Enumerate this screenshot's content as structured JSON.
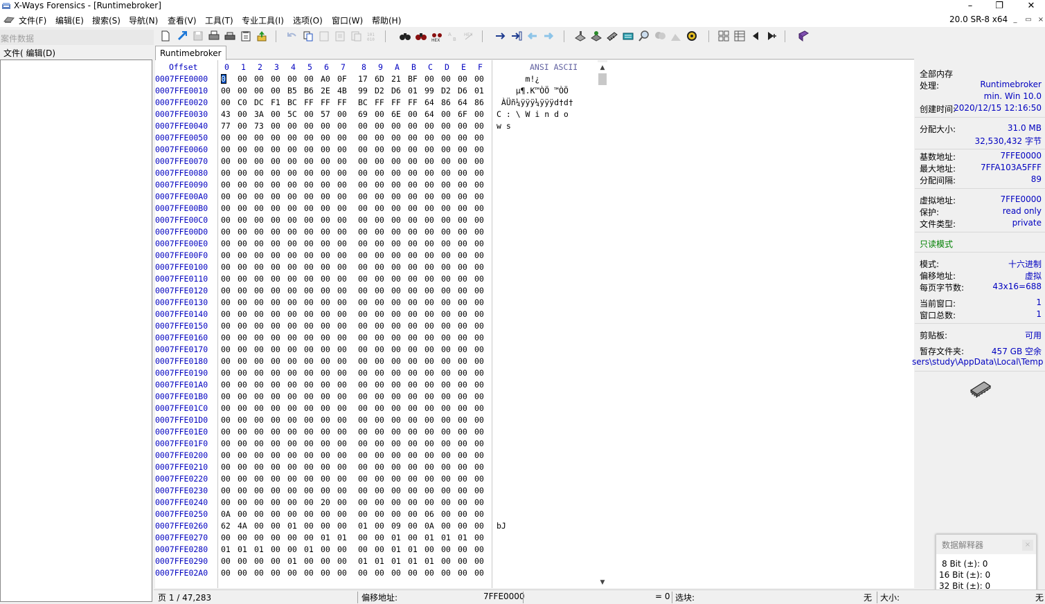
{
  "window": {
    "title": "X-Ways Forensics - [Runtimebroker]",
    "minimize": "–",
    "maximize": "❐",
    "close": "✕"
  },
  "menu": {
    "items": [
      "文件(F)",
      "编辑(E)",
      "搜索(S)",
      "导航(N)",
      "查看(V)",
      "工具(T)",
      "专业工具(I)",
      "选项(O)",
      "窗口(W)",
      "帮助(H)"
    ],
    "version": "20.0 SR-8 x64",
    "mdi_min": "_",
    "mdi_restore": "▭",
    "mdi_close": "×"
  },
  "left_panel": {
    "header": "案件数据",
    "menu_label": "文件(  编辑(D)"
  },
  "toolbar": {
    "icons": [
      "new-file-icon",
      "open-icon",
      "save-icon",
      "print-icon",
      "print-setup-icon",
      "properties-icon",
      "export-icon",
      "undo-icon",
      "copy-icon",
      "paste-icon",
      "paste-special-icon",
      "clipboard-icon",
      "convert-icon",
      "find-text-icon",
      "find-hex-icon",
      "find-hex-values-icon",
      "replace-text-icon",
      "replace-hex-icon",
      "goto-offset-icon",
      "goto-sector-icon",
      "back-icon",
      "forward-icon",
      "disk-icon",
      "disk-image-icon",
      "ram-icon",
      "calculator-icon",
      "search-icon",
      "fingerprint-icon",
      "chart-icon",
      "settings-gear-icon",
      "mode-icon",
      "layout-icon",
      "prev-icon",
      "next-icon",
      "case-icon"
    ]
  },
  "tab": {
    "label": "Runtimebroker"
  },
  "hex": {
    "offset_label": "Offset",
    "columns": [
      "0",
      "1",
      "2",
      "3",
      "4",
      "5",
      "6",
      "7",
      "8",
      "9",
      "A",
      "B",
      "C",
      "D",
      "E",
      "F"
    ],
    "ascii_label": "ANSI ASCII",
    "rows": [
      {
        "offset": "0007FFE0000",
        "bytes": [
          "00",
          "00",
          "00",
          "00",
          "00",
          "00",
          "A0",
          "0F",
          "17",
          "6D",
          "21",
          "BF",
          "00",
          "00",
          "00",
          "00"
        ],
        "ascii": "      m!¿"
      },
      {
        "offset": "0007FFE0010",
        "bytes": [
          "00",
          "00",
          "00",
          "00",
          "B5",
          "B6",
          "2E",
          "4B",
          "99",
          "D2",
          "D6",
          "01",
          "99",
          "D2",
          "D6",
          "01"
        ],
        "ascii": "    µ¶.K™ÒÖ ™ÒÖ"
      },
      {
        "offset": "0007FFE0020",
        "bytes": [
          "00",
          "C0",
          "DC",
          "F1",
          "BC",
          "FF",
          "FF",
          "FF",
          "BC",
          "FF",
          "FF",
          "FF",
          "64",
          "86",
          "64",
          "86"
        ],
        "ascii": " ÀÜñ¼ÿÿÿ¼ÿÿÿd†d†"
      },
      {
        "offset": "0007FFE0030",
        "bytes": [
          "43",
          "00",
          "3A",
          "00",
          "5C",
          "00",
          "57",
          "00",
          "69",
          "00",
          "6E",
          "00",
          "64",
          "00",
          "6F",
          "00"
        ],
        "ascii": "C : \\ W i n d o"
      },
      {
        "offset": "0007FFE0040",
        "bytes": [
          "77",
          "00",
          "73",
          "00",
          "00",
          "00",
          "00",
          "00",
          "00",
          "00",
          "00",
          "00",
          "00",
          "00",
          "00",
          "00"
        ],
        "ascii": "w s"
      },
      {
        "offset": "0007FFE0050",
        "bytes": [
          "00",
          "00",
          "00",
          "00",
          "00",
          "00",
          "00",
          "00",
          "00",
          "00",
          "00",
          "00",
          "00",
          "00",
          "00",
          "00"
        ],
        "ascii": ""
      },
      {
        "offset": "0007FFE0060",
        "bytes": [
          "00",
          "00",
          "00",
          "00",
          "00",
          "00",
          "00",
          "00",
          "00",
          "00",
          "00",
          "00",
          "00",
          "00",
          "00",
          "00"
        ],
        "ascii": ""
      },
      {
        "offset": "0007FFE0070",
        "bytes": [
          "00",
          "00",
          "00",
          "00",
          "00",
          "00",
          "00",
          "00",
          "00",
          "00",
          "00",
          "00",
          "00",
          "00",
          "00",
          "00"
        ],
        "ascii": ""
      },
      {
        "offset": "0007FFE0080",
        "bytes": [
          "00",
          "00",
          "00",
          "00",
          "00",
          "00",
          "00",
          "00",
          "00",
          "00",
          "00",
          "00",
          "00",
          "00",
          "00",
          "00"
        ],
        "ascii": ""
      },
      {
        "offset": "0007FFE0090",
        "bytes": [
          "00",
          "00",
          "00",
          "00",
          "00",
          "00",
          "00",
          "00",
          "00",
          "00",
          "00",
          "00",
          "00",
          "00",
          "00",
          "00"
        ],
        "ascii": ""
      },
      {
        "offset": "0007FFE00A0",
        "bytes": [
          "00",
          "00",
          "00",
          "00",
          "00",
          "00",
          "00",
          "00",
          "00",
          "00",
          "00",
          "00",
          "00",
          "00",
          "00",
          "00"
        ],
        "ascii": ""
      },
      {
        "offset": "0007FFE00B0",
        "bytes": [
          "00",
          "00",
          "00",
          "00",
          "00",
          "00",
          "00",
          "00",
          "00",
          "00",
          "00",
          "00",
          "00",
          "00",
          "00",
          "00"
        ],
        "ascii": ""
      },
      {
        "offset": "0007FFE00C0",
        "bytes": [
          "00",
          "00",
          "00",
          "00",
          "00",
          "00",
          "00",
          "00",
          "00",
          "00",
          "00",
          "00",
          "00",
          "00",
          "00",
          "00"
        ],
        "ascii": ""
      },
      {
        "offset": "0007FFE00D0",
        "bytes": [
          "00",
          "00",
          "00",
          "00",
          "00",
          "00",
          "00",
          "00",
          "00",
          "00",
          "00",
          "00",
          "00",
          "00",
          "00",
          "00"
        ],
        "ascii": ""
      },
      {
        "offset": "0007FFE00E0",
        "bytes": [
          "00",
          "00",
          "00",
          "00",
          "00",
          "00",
          "00",
          "00",
          "00",
          "00",
          "00",
          "00",
          "00",
          "00",
          "00",
          "00"
        ],
        "ascii": ""
      },
      {
        "offset": "0007FFE00F0",
        "bytes": [
          "00",
          "00",
          "00",
          "00",
          "00",
          "00",
          "00",
          "00",
          "00",
          "00",
          "00",
          "00",
          "00",
          "00",
          "00",
          "00"
        ],
        "ascii": ""
      },
      {
        "offset": "0007FFE0100",
        "bytes": [
          "00",
          "00",
          "00",
          "00",
          "00",
          "00",
          "00",
          "00",
          "00",
          "00",
          "00",
          "00",
          "00",
          "00",
          "00",
          "00"
        ],
        "ascii": ""
      },
      {
        "offset": "0007FFE0110",
        "bytes": [
          "00",
          "00",
          "00",
          "00",
          "00",
          "00",
          "00",
          "00",
          "00",
          "00",
          "00",
          "00",
          "00",
          "00",
          "00",
          "00"
        ],
        "ascii": ""
      },
      {
        "offset": "0007FFE0120",
        "bytes": [
          "00",
          "00",
          "00",
          "00",
          "00",
          "00",
          "00",
          "00",
          "00",
          "00",
          "00",
          "00",
          "00",
          "00",
          "00",
          "00"
        ],
        "ascii": ""
      },
      {
        "offset": "0007FFE0130",
        "bytes": [
          "00",
          "00",
          "00",
          "00",
          "00",
          "00",
          "00",
          "00",
          "00",
          "00",
          "00",
          "00",
          "00",
          "00",
          "00",
          "00"
        ],
        "ascii": ""
      },
      {
        "offset": "0007FFE0140",
        "bytes": [
          "00",
          "00",
          "00",
          "00",
          "00",
          "00",
          "00",
          "00",
          "00",
          "00",
          "00",
          "00",
          "00",
          "00",
          "00",
          "00"
        ],
        "ascii": ""
      },
      {
        "offset": "0007FFE0150",
        "bytes": [
          "00",
          "00",
          "00",
          "00",
          "00",
          "00",
          "00",
          "00",
          "00",
          "00",
          "00",
          "00",
          "00",
          "00",
          "00",
          "00"
        ],
        "ascii": ""
      },
      {
        "offset": "0007FFE0160",
        "bytes": [
          "00",
          "00",
          "00",
          "00",
          "00",
          "00",
          "00",
          "00",
          "00",
          "00",
          "00",
          "00",
          "00",
          "00",
          "00",
          "00"
        ],
        "ascii": ""
      },
      {
        "offset": "0007FFE0170",
        "bytes": [
          "00",
          "00",
          "00",
          "00",
          "00",
          "00",
          "00",
          "00",
          "00",
          "00",
          "00",
          "00",
          "00",
          "00",
          "00",
          "00"
        ],
        "ascii": ""
      },
      {
        "offset": "0007FFE0180",
        "bytes": [
          "00",
          "00",
          "00",
          "00",
          "00",
          "00",
          "00",
          "00",
          "00",
          "00",
          "00",
          "00",
          "00",
          "00",
          "00",
          "00"
        ],
        "ascii": ""
      },
      {
        "offset": "0007FFE0190",
        "bytes": [
          "00",
          "00",
          "00",
          "00",
          "00",
          "00",
          "00",
          "00",
          "00",
          "00",
          "00",
          "00",
          "00",
          "00",
          "00",
          "00"
        ],
        "ascii": ""
      },
      {
        "offset": "0007FFE01A0",
        "bytes": [
          "00",
          "00",
          "00",
          "00",
          "00",
          "00",
          "00",
          "00",
          "00",
          "00",
          "00",
          "00",
          "00",
          "00",
          "00",
          "00"
        ],
        "ascii": ""
      },
      {
        "offset": "0007FFE01B0",
        "bytes": [
          "00",
          "00",
          "00",
          "00",
          "00",
          "00",
          "00",
          "00",
          "00",
          "00",
          "00",
          "00",
          "00",
          "00",
          "00",
          "00"
        ],
        "ascii": ""
      },
      {
        "offset": "0007FFE01C0",
        "bytes": [
          "00",
          "00",
          "00",
          "00",
          "00",
          "00",
          "00",
          "00",
          "00",
          "00",
          "00",
          "00",
          "00",
          "00",
          "00",
          "00"
        ],
        "ascii": ""
      },
      {
        "offset": "0007FFE01D0",
        "bytes": [
          "00",
          "00",
          "00",
          "00",
          "00",
          "00",
          "00",
          "00",
          "00",
          "00",
          "00",
          "00",
          "00",
          "00",
          "00",
          "00"
        ],
        "ascii": ""
      },
      {
        "offset": "0007FFE01E0",
        "bytes": [
          "00",
          "00",
          "00",
          "00",
          "00",
          "00",
          "00",
          "00",
          "00",
          "00",
          "00",
          "00",
          "00",
          "00",
          "00",
          "00"
        ],
        "ascii": ""
      },
      {
        "offset": "0007FFE01F0",
        "bytes": [
          "00",
          "00",
          "00",
          "00",
          "00",
          "00",
          "00",
          "00",
          "00",
          "00",
          "00",
          "00",
          "00",
          "00",
          "00",
          "00"
        ],
        "ascii": ""
      },
      {
        "offset": "0007FFE0200",
        "bytes": [
          "00",
          "00",
          "00",
          "00",
          "00",
          "00",
          "00",
          "00",
          "00",
          "00",
          "00",
          "00",
          "00",
          "00",
          "00",
          "00"
        ],
        "ascii": ""
      },
      {
        "offset": "0007FFE0210",
        "bytes": [
          "00",
          "00",
          "00",
          "00",
          "00",
          "00",
          "00",
          "00",
          "00",
          "00",
          "00",
          "00",
          "00",
          "00",
          "00",
          "00"
        ],
        "ascii": ""
      },
      {
        "offset": "0007FFE0220",
        "bytes": [
          "00",
          "00",
          "00",
          "00",
          "00",
          "00",
          "00",
          "00",
          "00",
          "00",
          "00",
          "00",
          "00",
          "00",
          "00",
          "00"
        ],
        "ascii": ""
      },
      {
        "offset": "0007FFE0230",
        "bytes": [
          "00",
          "00",
          "00",
          "00",
          "00",
          "00",
          "00",
          "00",
          "00",
          "00",
          "00",
          "00",
          "00",
          "00",
          "00",
          "00"
        ],
        "ascii": ""
      },
      {
        "offset": "0007FFE0240",
        "bytes": [
          "00",
          "00",
          "00",
          "00",
          "00",
          "00",
          "20",
          "00",
          "00",
          "00",
          "00",
          "00",
          "00",
          "00",
          "00",
          "00"
        ],
        "ascii": ""
      },
      {
        "offset": "0007FFE0250",
        "bytes": [
          "0A",
          "00",
          "00",
          "00",
          "00",
          "00",
          "00",
          "00",
          "00",
          "00",
          "00",
          "00",
          "06",
          "00",
          "00",
          "00"
        ],
        "ascii": ""
      },
      {
        "offset": "0007FFE0260",
        "bytes": [
          "62",
          "4A",
          "00",
          "00",
          "01",
          "00",
          "00",
          "00",
          "01",
          "00",
          "09",
          "00",
          "0A",
          "00",
          "00",
          "00"
        ],
        "ascii": "bJ"
      },
      {
        "offset": "0007FFE0270",
        "bytes": [
          "00",
          "00",
          "00",
          "00",
          "00",
          "00",
          "01",
          "01",
          "00",
          "00",
          "01",
          "00",
          "01",
          "01",
          "01",
          "00"
        ],
        "ascii": ""
      },
      {
        "offset": "0007FFE0280",
        "bytes": [
          "01",
          "01",
          "01",
          "00",
          "00",
          "01",
          "00",
          "00",
          "00",
          "00",
          "01",
          "01",
          "00",
          "00",
          "00",
          "00"
        ],
        "ascii": ""
      },
      {
        "offset": "0007FFE0290",
        "bytes": [
          "00",
          "00",
          "00",
          "00",
          "01",
          "00",
          "00",
          "00",
          "01",
          "01",
          "01",
          "01",
          "01",
          "00",
          "00",
          "00"
        ],
        "ascii": ""
      },
      {
        "offset": "0007FFE02A0",
        "bytes": [
          "00",
          "00",
          "00",
          "00",
          "00",
          "00",
          "00",
          "00",
          "00",
          "00",
          "00",
          "00",
          "00",
          "00",
          "00",
          "00"
        ],
        "ascii": ""
      }
    ]
  },
  "info": {
    "all_memory": "全部内存",
    "process_label": "处理:",
    "process_value": "Runtimebroker",
    "min_win": "min. Win 10.0",
    "created_label": "创建时间:",
    "created_value": "2020/12/15  12:16:50",
    "alloc_size_label": "分配大小:",
    "alloc_size_mb": "31.0 MB",
    "alloc_size_bytes": "32,530,432 字节",
    "base_label": "基数地址:",
    "base_value": "7FFE0000",
    "max_label": "最大地址:",
    "max_value": "7FFA103A5FFF",
    "gap_label": "分配间隔:",
    "gap_value": "89",
    "vaddr_label": "虚拟地址:",
    "vaddr_value": "7FFE0000",
    "protect_label": "保护:",
    "protect_value": "read only",
    "ftype_label": "文件类型:",
    "ftype_value": "private",
    "readonly_mode": "只读模式",
    "mode_label": "模式:",
    "mode_value": "十六进制",
    "offaddr_label": "偏移地址:",
    "offaddr_value": "虚拟",
    "bpp_label": "每页字节数:",
    "bpp_value": "43x16=688",
    "curwin_label": "当前窗口:",
    "curwin_value": "1",
    "totwin_label": "窗口总数:",
    "totwin_value": "1",
    "clip_label": "剪贴板:",
    "clip_value": "可用",
    "temp_label": "暂存文件夹:",
    "temp_value": "457 GB 空余",
    "temp_path": "sers\\study\\AppData\\Local\\Temp"
  },
  "data_interpreter": {
    "title": "数据解释器",
    "close": "×",
    "bit8": "8 Bit (±): 0",
    "bit16": "16 Bit (±): 0",
    "bit32": "32 Bit (±): 0"
  },
  "status": {
    "page": "页 1 / 47,283",
    "offset_label": "偏移地址:",
    "offset_value": "7FFE0000",
    "eq": "= 0",
    "sel_label": "选块:",
    "sel_value": "无",
    "size_label": "大小:",
    "size_value": "无"
  }
}
